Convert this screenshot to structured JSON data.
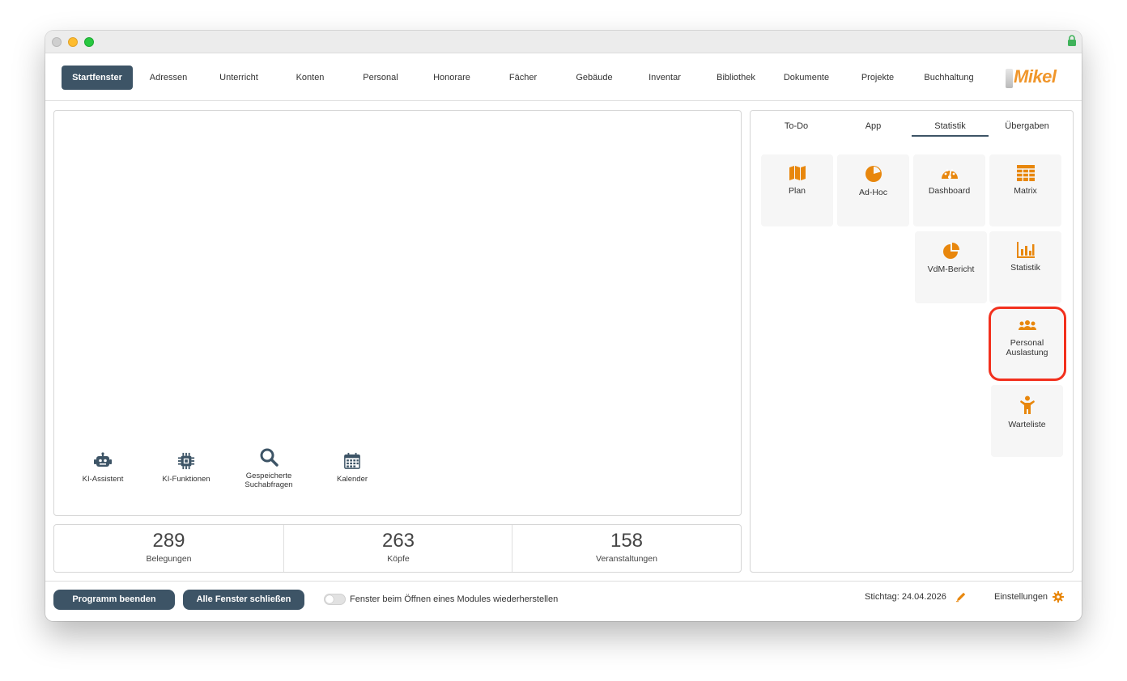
{
  "nav": {
    "items": [
      {
        "label": "Startfenster",
        "active": true
      },
      {
        "label": "Adressen"
      },
      {
        "label": "Unterricht"
      },
      {
        "label": "Konten"
      },
      {
        "label": "Personal"
      },
      {
        "label": "Honorare"
      },
      {
        "label": "Fächer"
      },
      {
        "label": "Gebäude"
      },
      {
        "label": "Inventar"
      },
      {
        "label": "Bibliothek"
      },
      {
        "label": "Dokumente"
      },
      {
        "label": "Projekte"
      },
      {
        "label": "Buchhaltung"
      }
    ],
    "logo_text": "Mikel"
  },
  "quick_access": [
    {
      "label": "KI-Assistent",
      "icon": "robot-icon"
    },
    {
      "label": "KI-Funktionen",
      "icon": "chip-icon"
    },
    {
      "label": "Gespeicherte Suchabfragen",
      "icon": "search-icon"
    },
    {
      "label": "Kalender",
      "icon": "calendar-icon"
    }
  ],
  "stats": [
    {
      "value": "289",
      "label": "Belegungen"
    },
    {
      "value": "263",
      "label": "Köpfe"
    },
    {
      "value": "158",
      "label": "Veranstaltungen"
    }
  ],
  "side_tabs": [
    {
      "label": "To-Do"
    },
    {
      "label": "App"
    },
    {
      "label": "Statistik",
      "active": true
    },
    {
      "label": "Übergaben"
    }
  ],
  "tiles": [
    {
      "label": "Plan",
      "icon": "map-icon"
    },
    {
      "label": "Ad-Hoc",
      "icon": "pie-chart-icon"
    },
    {
      "label": "Dashboard",
      "icon": "gauge-icon"
    },
    {
      "label": "Matrix",
      "icon": "table-icon"
    },
    {
      "label": "VdM-Bericht",
      "icon": "pie-slice-icon"
    },
    {
      "label": "Statistik",
      "icon": "bar-chart-icon"
    },
    {
      "label": "Personal Auslastung",
      "icon": "users-icon"
    },
    {
      "label": "Warteliste",
      "icon": "child-icon"
    }
  ],
  "footer": {
    "quit_label": "Programm beenden",
    "close_all_label": "Alle Fenster schließen",
    "toggle_label": "Fenster beim Öffnen eines Modules wiederherstellen",
    "stichtag_label": "Stichtag: 24.04.2026",
    "settings_label": "Einstellungen"
  },
  "colors": {
    "accent": "#3d5466",
    "icon_orange": "#e8870d",
    "highlight": "#f2301d"
  }
}
